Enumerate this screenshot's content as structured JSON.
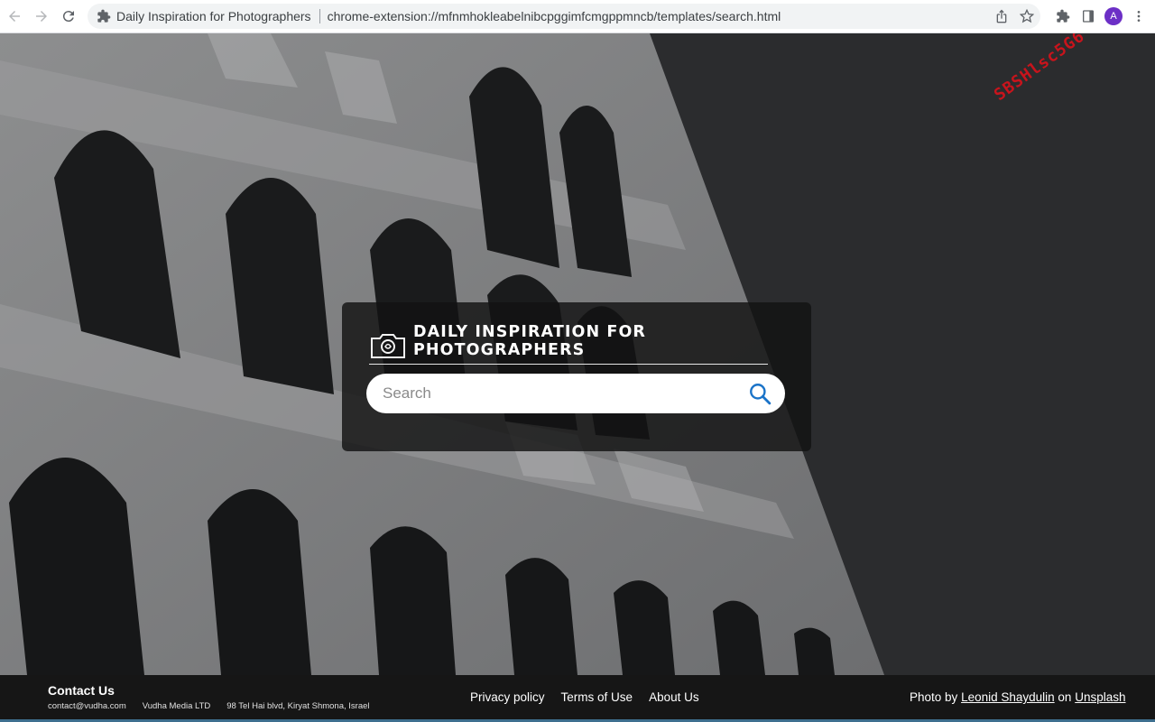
{
  "browser": {
    "tab_title": "Daily Inspiration for Photographers",
    "url": "chrome-extension://mfnmhokleabelnibcpggimfcmgppmncb/templates/search.html",
    "avatar_letter": "A",
    "avatar_color": "#6c2fc6"
  },
  "watermark": "SBSHlsc5G6",
  "search": {
    "brand_title": "DAILY INSPIRATION FOR PHOTOGRAPHERS",
    "placeholder": "Search",
    "value": "",
    "button_icon": "search-icon",
    "accent_color": "#1a73c8"
  },
  "footer": {
    "contact_title": "Contact Us",
    "email": "contact@vudha.com",
    "company": "Vudha Media LTD",
    "address": "98 Tel Hai blvd, Kiryat Shmona, Israel",
    "links": [
      "Privacy policy",
      "Terms of Use",
      "About Us"
    ],
    "credit_prefix": "Photo by",
    "photographer": "Leonid Shaydulin",
    "credit_middle": "on",
    "source": "Unsplash"
  }
}
